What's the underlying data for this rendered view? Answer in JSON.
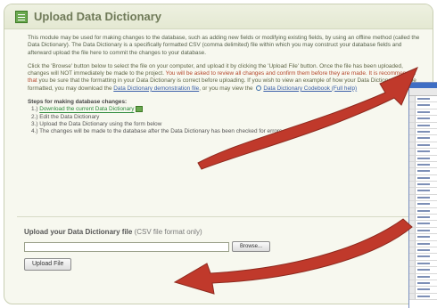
{
  "panel": {
    "title": "Upload Data Dictionary"
  },
  "intro": {
    "text": "This module may be used for making changes to the database, such as adding new fields or modifying existing fields, by using an offline method (called the Data Dictionary). The Data Dictionary is a specifically formatted CSV (comma delimited) file within which you may construct your database fields and afterward upload the file here to commit the changes to your database."
  },
  "instructions": {
    "text_before": "Click the 'Browse' button below to select the file on your computer, and upload it by clicking the 'Upload File' button. Once the file has been uploaded, changes will NOT immediately be made to the project. ",
    "warning": "You will be asked to review all changes and confirm them before they are made. It is recommended that",
    "text_middle": " you be sure that the formatting in your Data Dictionary is correct before uploading. If you wish to view an example of how your Data Dictionary may be formatted, you may download the ",
    "link_demo": "Data Dictionary demonstration file",
    "text_after": ", or you may view the ",
    "link_codebook": "Data Dictionary Codebook (Full help)"
  },
  "steps": {
    "title": "Steps for making database changes:",
    "items": [
      {
        "prefix": "1.) ",
        "link": "Download the current Data Dictionary"
      },
      {
        "prefix": "2.) ",
        "text": "Edit the Data Dictionary"
      },
      {
        "prefix": "3.) ",
        "text": "Upload the Data Dictionary using the form below"
      },
      {
        "prefix": "4.) ",
        "text": "The changes will be made to the database after the Data Dictionary has been checked for errors"
      }
    ]
  },
  "upload": {
    "label": "Upload your Data Dictionary file",
    "hint": "(CSV file format only)",
    "file_value": "",
    "browse_label": "Browse...",
    "upload_label": "Upload File"
  },
  "icons": {
    "header": "data-dictionary-icon",
    "download": "spreadsheet-icon",
    "codebook": "magnifier-icon"
  },
  "colors": {
    "arrow": "#c0392b",
    "panel_bg": "#f7f8ef",
    "title": "#6f7a58",
    "step_link": "#2b8a3a"
  }
}
